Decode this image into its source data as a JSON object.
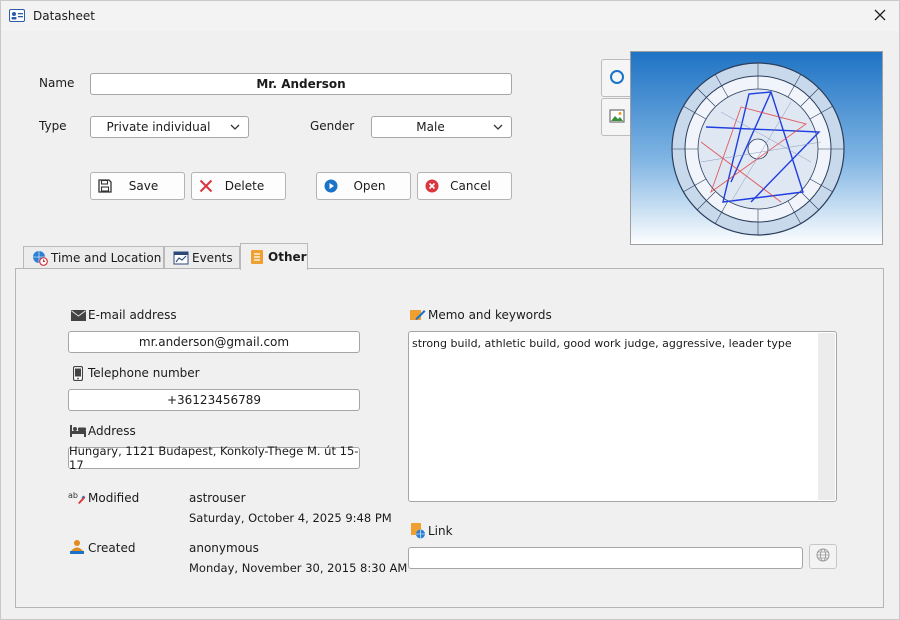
{
  "window": {
    "title": "Datasheet"
  },
  "form": {
    "name_label": "Name",
    "name_value": "Mr. Anderson",
    "type_label": "Type",
    "type_value": "Private individual",
    "gender_label": "Gender",
    "gender_value": "Male"
  },
  "buttons": {
    "save": "Save",
    "delete": "Delete",
    "open": "Open",
    "cancel": "Cancel"
  },
  "tabs": [
    {
      "label": "Time and Location",
      "icon": "globe-clock-icon",
      "active": false
    },
    {
      "label": "Events",
      "icon": "chart-window-icon",
      "active": false
    },
    {
      "label": "Other",
      "icon": "document-orange-icon",
      "active": true
    }
  ],
  "other": {
    "email_label": "E-mail address",
    "email_value": "mr.anderson@gmail.com",
    "phone_label": "Telephone number",
    "phone_value": "+36123456789",
    "address_label": "Address",
    "address_value": "Hungary, 1121 Budapest, Konkoly-Thege M. út 15-17",
    "modified_label": "Modified",
    "modified_user": "astrouser",
    "modified_date": "Saturday, October 4, 2025 9:48 PM",
    "created_label": "Created",
    "created_user": "anonymous",
    "created_date": "Monday, November 30, 2015 8:30 AM",
    "memo_label": "Memo and keywords",
    "memo_value": "strong build, athletic build, good work judge, aggressive, leader type",
    "link_label": "Link",
    "link_value": ""
  },
  "colors": {
    "accent_blue": "#1a73c8",
    "delete_red": "#d9363e",
    "other_tab_orange": "#f0a030"
  }
}
